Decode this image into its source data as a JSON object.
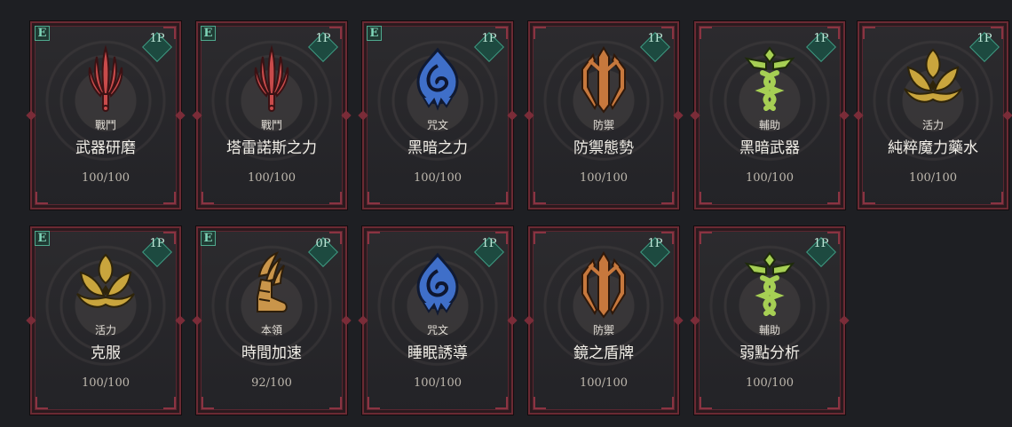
{
  "cards": [
    {
      "category": "戰鬥",
      "name": "武器研磨",
      "durability": "100/100",
      "cost": "1P",
      "equip_mark": "E",
      "icon": "sword-icon",
      "icon_color": "#c94b4b"
    },
    {
      "category": "戰鬥",
      "name": "塔雷諾斯之力",
      "durability": "100/100",
      "cost": "1P",
      "equip_mark": "E",
      "icon": "sword-icon",
      "icon_color": "#c94b4b"
    },
    {
      "category": "咒文",
      "name": "黑暗之力",
      "durability": "100/100",
      "cost": "1P",
      "equip_mark": "E",
      "icon": "spell-orb-icon",
      "icon_color": "#3f6fc9"
    },
    {
      "category": "防禦",
      "name": "防禦態勢",
      "durability": "100/100",
      "cost": "1P",
      "equip_mark": "",
      "icon": "shield-blade-icon",
      "icon_color": "#c7783d"
    },
    {
      "category": "輔助",
      "name": "黑暗武器",
      "durability": "100/100",
      "cost": "1P",
      "equip_mark": "",
      "icon": "caduceus-icon",
      "icon_color": "#a6cf54"
    },
    {
      "category": "活力",
      "name": "純粹魔力藥水",
      "durability": "100/100",
      "cost": "1P",
      "equip_mark": "",
      "icon": "lotus-icon",
      "icon_color": "#c9a53d"
    },
    {
      "category": "活力",
      "name": "克服",
      "durability": "100/100",
      "cost": "1P",
      "equip_mark": "E",
      "icon": "lotus-icon",
      "icon_color": "#c9a53d"
    },
    {
      "category": "本領",
      "name": "時間加速",
      "durability": "92/100",
      "cost": "0P",
      "equip_mark": "E",
      "icon": "winged-boot-icon",
      "icon_color": "#c9954a"
    },
    {
      "category": "咒文",
      "name": "睡眠誘導",
      "durability": "100/100",
      "cost": "1P",
      "equip_mark": "",
      "icon": "spell-orb-icon",
      "icon_color": "#3f6fc9"
    },
    {
      "category": "防禦",
      "name": "鏡之盾牌",
      "durability": "100/100",
      "cost": "1P",
      "equip_mark": "",
      "icon": "shield-blade-icon",
      "icon_color": "#c7783d"
    },
    {
      "category": "輔助",
      "name": "弱點分析",
      "durability": "100/100",
      "cost": "1P",
      "equip_mark": "",
      "icon": "caduceus-icon",
      "icon_color": "#a6cf54"
    }
  ]
}
